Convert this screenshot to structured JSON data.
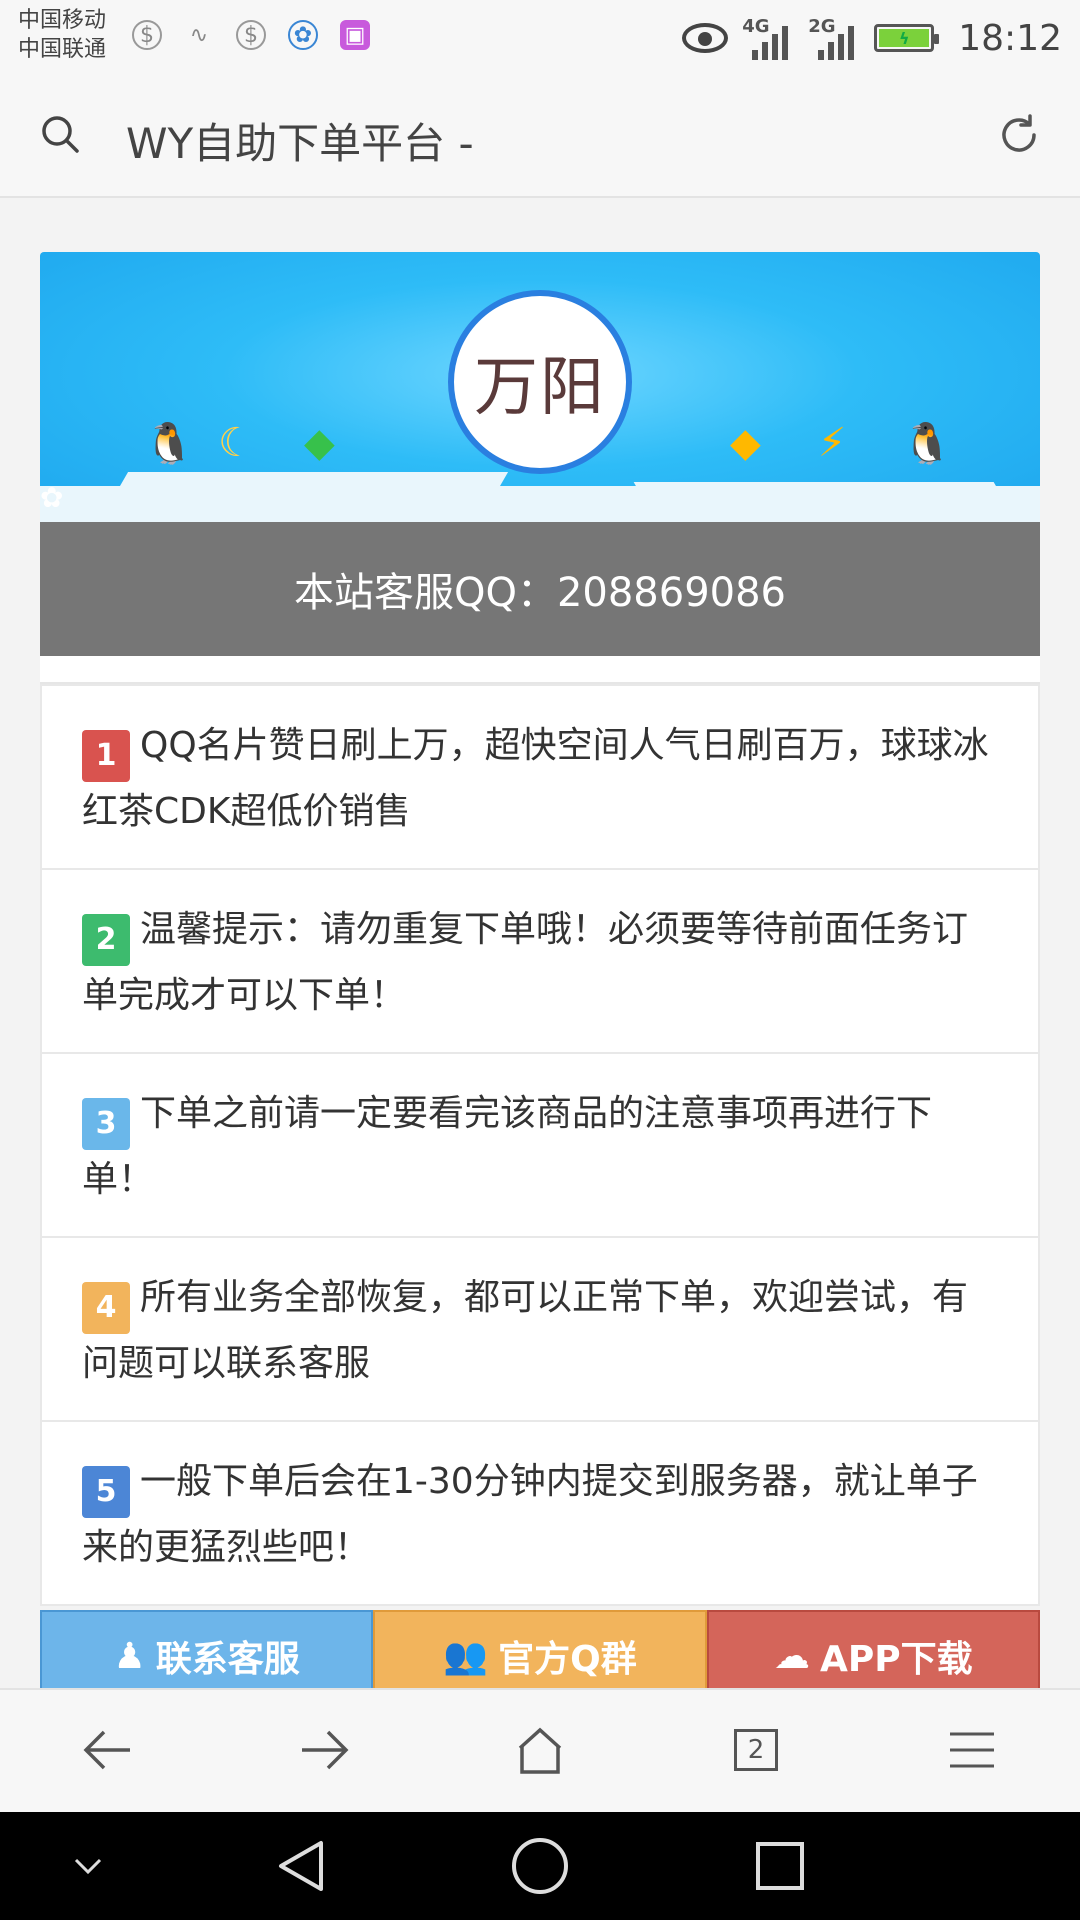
{
  "status_bar": {
    "carrier_1": "中国移动",
    "carrier_2": "中国联通",
    "net_1": "4G",
    "net_2": "2G",
    "time": "18:12"
  },
  "browser": {
    "title": "WY自助下单平台 -",
    "tabs_count": "2"
  },
  "banner": {
    "logo_text": "万阳",
    "service_text": "本站客服QQ：208869086"
  },
  "notices": [
    {
      "num": "1",
      "color": "#d9534f",
      "text": "QQ名片赞日刷上万，超快空间人气日刷百万，球球冰红茶CDK超低价销售"
    },
    {
      "num": "2",
      "color": "#3dbb6e",
      "text": "温馨提示：请勿重复下单哦！必须要等待前面任务订单完成才可以下单！"
    },
    {
      "num": "3",
      "color": "#6ab7ea",
      "text": "下单之前请一定要看完该商品的注意事项再进行下单！"
    },
    {
      "num": "4",
      "color": "#f2b45c",
      "text": "所有业务全部恢复，都可以正常下单，欢迎尝试，有问题可以联系客服"
    },
    {
      "num": "5",
      "color": "#4c86d6",
      "text": "一般下单后会在1-30分钟内提交到服务器，就让单子来的更猛烈些吧！"
    }
  ],
  "buttons": {
    "service": "联系客服",
    "group": "官方Q群",
    "app": "APP下载"
  }
}
